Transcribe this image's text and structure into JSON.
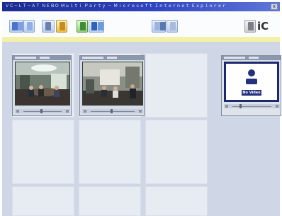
{
  "window": {
    "title": "ＶＣ－ＬＴ－ＡＴ ＮＥＢＯ Ｍｕｌｔｉ Ｐａｒｔｙ － Ｍｉｃｒｏｓｏｆｔ Ｉｎｔｅｒｎｅｔ Ｅｘｐｌｏｒｅｒ",
    "close_glyph": "x"
  },
  "toolbar": {
    "buttons": [
      {
        "name": "layout-view-button",
        "icon": "layout-icon"
      },
      {
        "name": "refresh-button",
        "icon": "refresh-icon"
      },
      {
        "name": "open-folder-button",
        "icon": "folder-icon"
      },
      {
        "name": "lock-button",
        "icon": "lock-icon"
      },
      {
        "name": "participants-button",
        "icon": "people-icon"
      },
      {
        "name": "camera-toggle-button",
        "icon": "camera-icon"
      },
      {
        "name": "settings-button",
        "icon": "settings-icon"
      }
    ],
    "brand_text": "iC"
  },
  "video_windows": [
    {
      "slot": 1,
      "state": "live",
      "volume_level": 0.45
    },
    {
      "slot": 2,
      "state": "live",
      "volume_level": 0.45
    },
    {
      "slot": 4,
      "state": "no-video",
      "label": "No Video",
      "volume_level": 0.2
    }
  ],
  "colors": {
    "titlebar": "#1b2b8f",
    "workspace": "#cfd7e6",
    "no_video_border": "#1e2870",
    "highlight_bar": "#f4f1a6"
  }
}
